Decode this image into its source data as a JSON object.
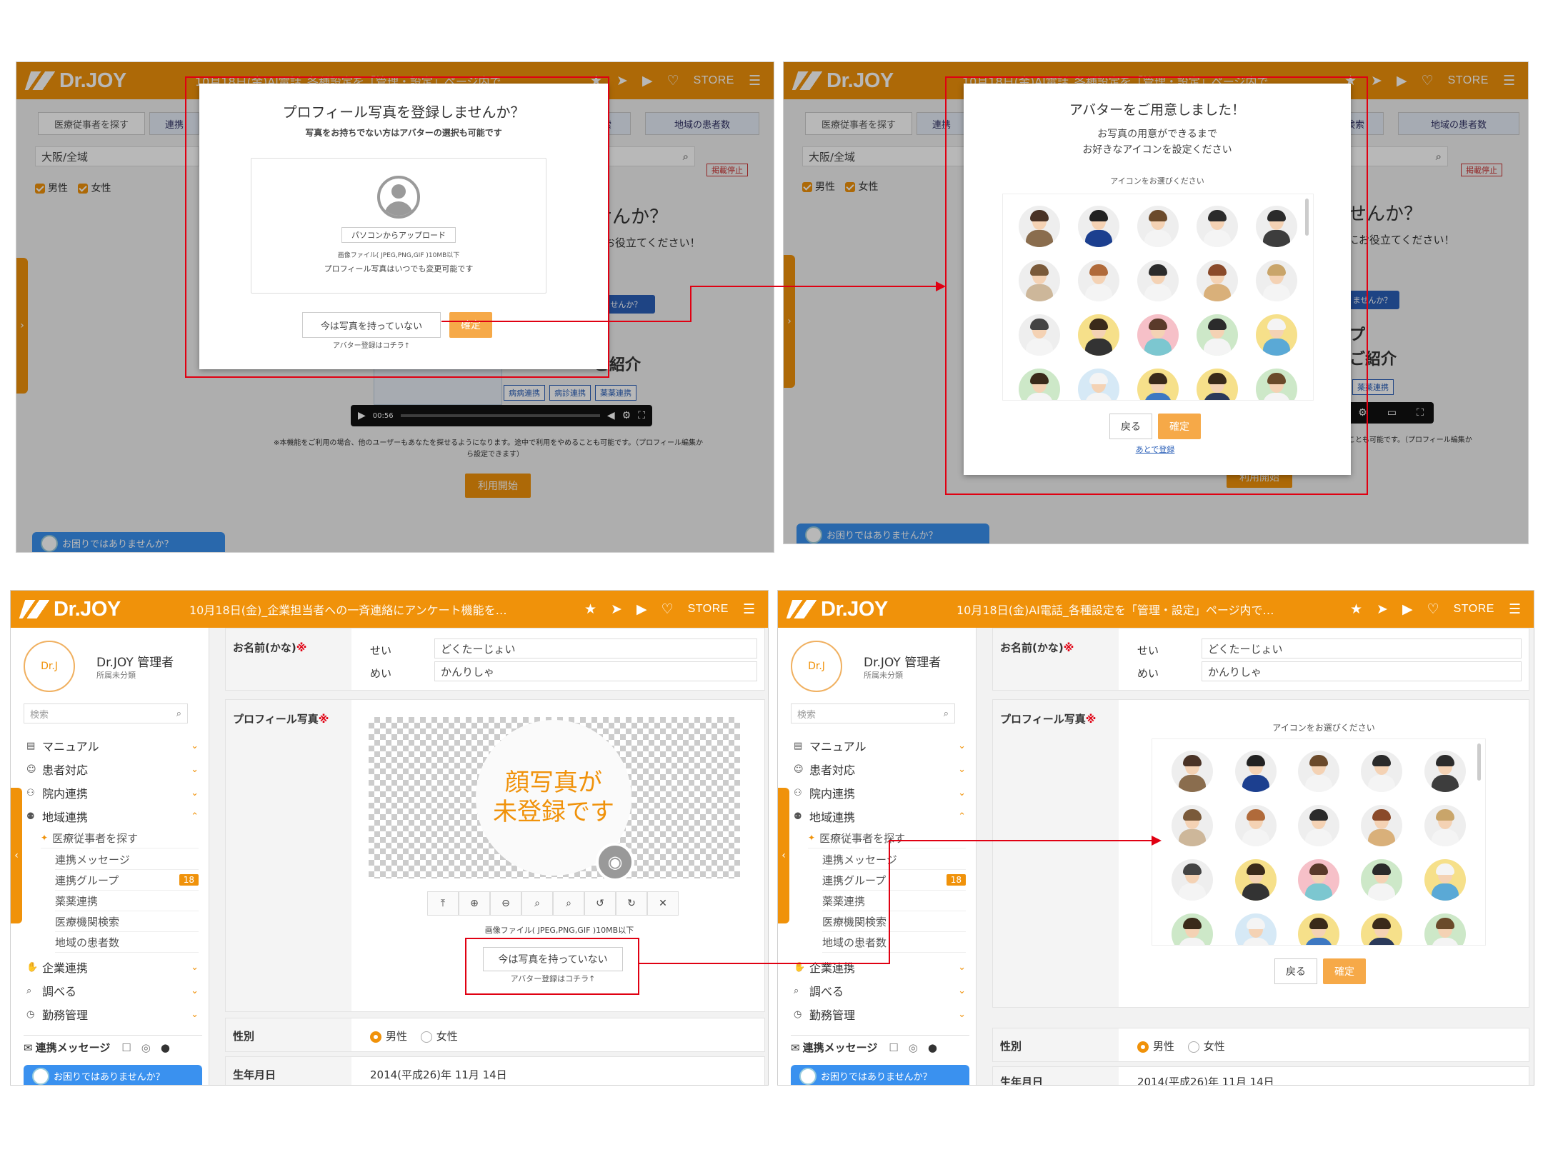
{
  "header": {
    "logo": "Dr.JOY",
    "marquee_top": "10月18日(金)AI電話_各種設定を「管理・設定」ページ内で…",
    "marquee_bl": "10月18日(金)_企業担当者への一斉連絡にアンケート機能を…",
    "marquee_br": "10月18日(金)AI電話_各種設定を「管理・設定」ページ内で…",
    "store": "STORE",
    "icons": [
      "star-icon",
      "send-icon",
      "play-icon",
      "bulb-icon",
      "menu-icon"
    ]
  },
  "bg": {
    "tab1": "医療従事者を探す",
    "tab2": "連携",
    "tab3": "検索",
    "tab4": "地域の患者数",
    "region_select": "大阪/全域",
    "male": "男性",
    "female": "女性",
    "tag_stop": "掲載停止",
    "heading_tail": "せんか？",
    "sub_tail": "にお役立てください！",
    "blue_btn": "ませんか？",
    "big_p": "プ",
    "big_intro": "ご紹介",
    "tag1": "病病連携",
    "tag2": "病診連携",
    "tag3": "薬薬連携",
    "video_time": "00:56",
    "notice": "※本機能をご利用の場合、他のユーザーもあなたを探せるようになります。途中で利用をやめることも可能です。（プロフィール編集か",
    "notice2": "ら設定できます）",
    "notice_tail": "ことも可能です。（プロフィール編集か",
    "start": "利用開始",
    "help": "お困りではありませんか？"
  },
  "modal1": {
    "title": "プロフィール写真を登録しませんか？",
    "subtitle": "写真をお持ちでない方はアバターの選択も可能です",
    "upload": "パソコンからアップロード",
    "filetype": "画像ファイル( JPEG,PNG,GIF )10MB以下",
    "changeable": "プロフィール写真はいつでも変更可能です",
    "no_photo": "今は写真を持っていない",
    "avatar_hint": "アバター登録はコチラ↑",
    "confirm": "確定"
  },
  "modal2": {
    "title": "アバターをご用意しました！",
    "line1": "お写真の用意ができるまで",
    "line2": "お好きなアイコンを設定ください",
    "choose": "アイコンをお選びください",
    "back": "戻る",
    "confirm": "確定",
    "later": "あとで登録"
  },
  "avatars": [
    {
      "bg": "#eeeeee",
      "hair": "#4a3326",
      "body": "#8a6d4e"
    },
    {
      "bg": "#eeeeee",
      "hair": "#222222",
      "body": "#1c3f8f"
    },
    {
      "bg": "#eeeeee",
      "hair": "#6b4a2b",
      "body": "#f4f4f4"
    },
    {
      "bg": "#eeeeee",
      "hair": "#2b2b2b",
      "body": "#f4f4f4"
    },
    {
      "bg": "#eeeeee",
      "hair": "#2b2b2b",
      "body": "#3d3d3d"
    },
    {
      "bg": "#eeeeee",
      "hair": "#7a5a3a",
      "body": "#cdb79a"
    },
    {
      "bg": "#eeeeee",
      "hair": "#b06a3a",
      "body": "#f4f4f4"
    },
    {
      "bg": "#eeeeee",
      "hair": "#2b2b2b",
      "body": "#f4f4f4"
    },
    {
      "bg": "#eeeeee",
      "hair": "#8a4a2a",
      "body": "#d9b07a"
    },
    {
      "bg": "#eeeeee",
      "hair": "#c9a56a",
      "body": "#f4f4f4"
    },
    {
      "bg": "#eeeeee",
      "hair": "#444444",
      "body": "#f4f4f4"
    },
    {
      "bg": "#f6e08a",
      "hair": "#3a2a1a",
      "body": "#333333"
    },
    {
      "bg": "#f6c0c8",
      "hair": "#5a3a2a",
      "body": "#7cc7d0"
    },
    {
      "bg": "#cde8c8",
      "hair": "#2b2b2b",
      "body": "#f4f4f4"
    },
    {
      "bg": "#f6e08a",
      "hair": "#f4f4f4",
      "body": "#5aa9d6"
    },
    {
      "bg": "#cde8c8",
      "hair": "#3a2a1a",
      "body": "#f4f4f4"
    },
    {
      "bg": "#d6e9f6",
      "hair": "#f4f4f4",
      "body": "#f4f4f4"
    },
    {
      "bg": "#f6e08a",
      "hair": "#3a2a1a",
      "body": "#3d78c2"
    },
    {
      "bg": "#f6e08a",
      "hair": "#3a2a1a",
      "body": "#2b3a5a"
    },
    {
      "bg": "#cde8c8",
      "hair": "#6a4a2a",
      "body": "#f4f4f4"
    }
  ],
  "sidebar": {
    "avatar_text": "Dr.J",
    "name": "Dr.JOY 管理者",
    "dept": "所属未分類",
    "search_placeholder": "検索",
    "menu": [
      {
        "label": "マニュアル",
        "icon": "book-icon"
      },
      {
        "label": "患者対応",
        "icon": "face-icon"
      },
      {
        "label": "院内連携",
        "icon": "org-icon"
      },
      {
        "label": "地域連携",
        "icon": "people-icon"
      }
    ],
    "sub": [
      "医療従事者を探す",
      "連携メッセージ",
      "連携グループ",
      "薬薬連携",
      "医療機関検索",
      "地域の患者数"
    ],
    "badge": "18",
    "menu2": [
      {
        "label": "企業連携",
        "icon": "handshake-icon"
      },
      {
        "label": "調べる",
        "icon": "search-icon"
      },
      {
        "label": "勤務管理",
        "icon": "clock-icon"
      }
    ],
    "bottom_msg": "連携メッセージ",
    "help": "お困りではありませんか？"
  },
  "form": {
    "name_label": "お名前(かな)",
    "req": "※",
    "sei": "せい",
    "mei": "めい",
    "sei_val": "どくたーじょい",
    "mei_val": "かんりしゃ",
    "photo_label": "プロフィール写真",
    "no_face_l1": "顔写真が",
    "no_face_l2": "未登録です",
    "filetype": "画像ファイル( JPEG,PNG,GIF )10MB以下",
    "no_photo": "今は写真を持っていない",
    "avatar_hint": "アバター登録はコチラ↑",
    "choose": "アイコンをお選びください",
    "back": "戻る",
    "confirm": "確定",
    "gender_label": "性別",
    "male": "男性",
    "female": "女性",
    "birth_label": "生年月日",
    "birth_val": "2014(平成26)年 11月 14日"
  }
}
